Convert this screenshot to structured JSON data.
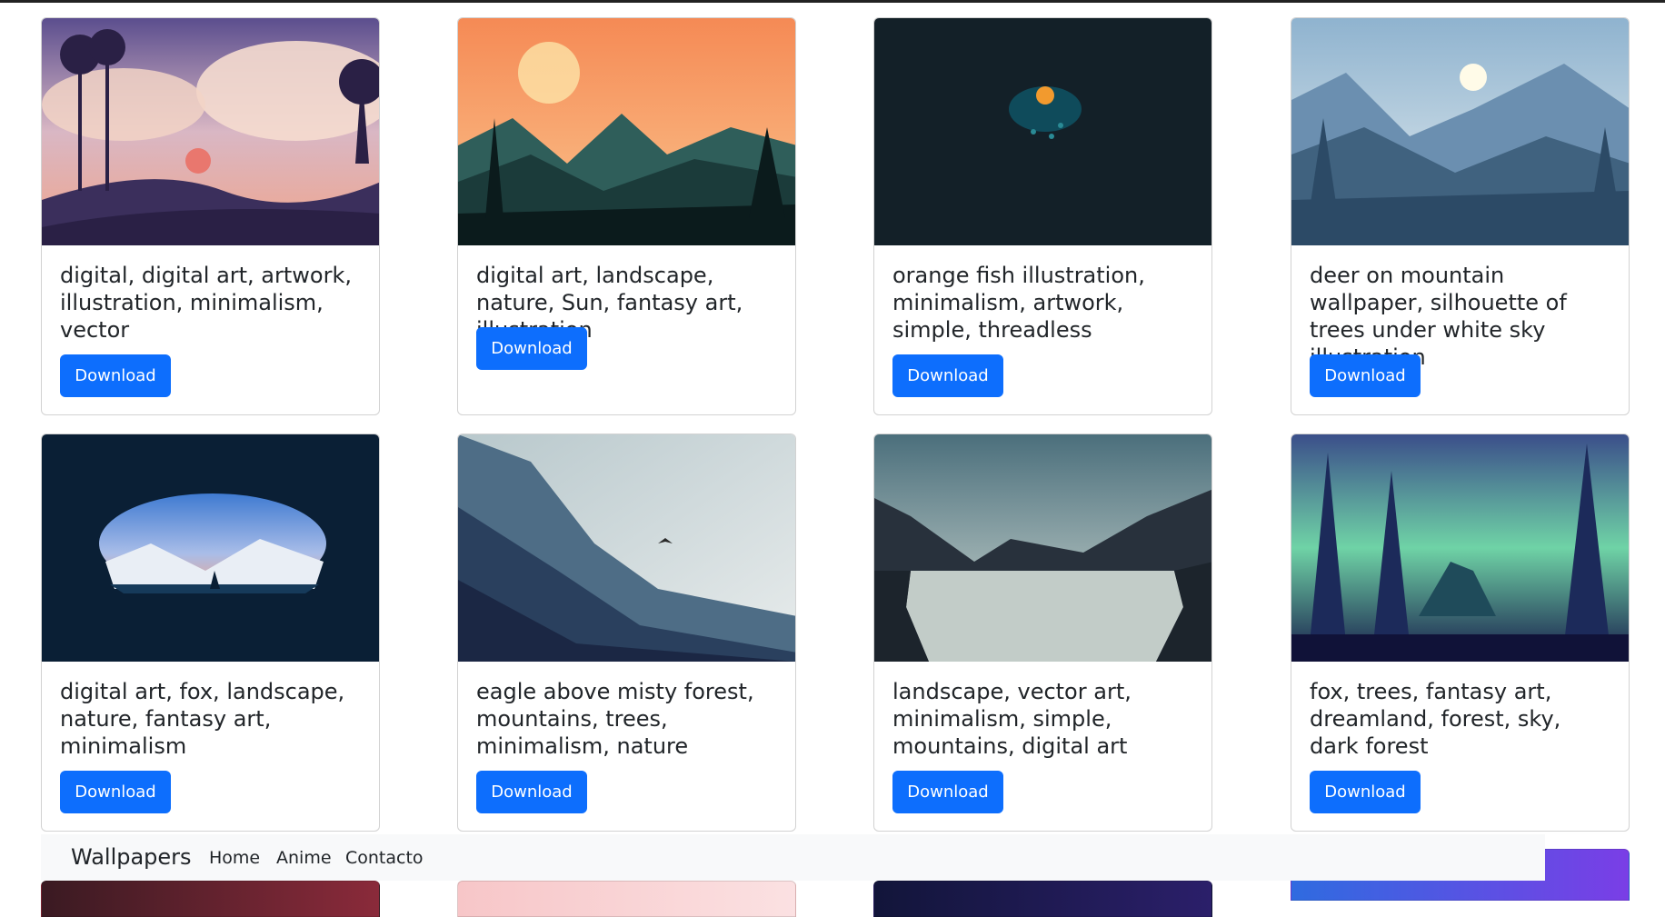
{
  "navbar": {
    "brand": "Wallpapers",
    "links": [
      "Home",
      "Anime",
      "Contacto"
    ]
  },
  "cards": [
    {
      "title": "digital, digital art, artwork, illustration, minimalism, vector",
      "button": "Download"
    },
    {
      "title": "digital art, landscape, nature, Sun, fantasy art, illustration",
      "button": "Download"
    },
    {
      "title": "orange fish illustration, minimalism, artwork, simple, threadless",
      "button": "Download"
    },
    {
      "title": "deer on mountain wallpaper, silhouette of trees under white sky illustration",
      "button": "Download"
    },
    {
      "title": "digital art, fox, landscape, nature, fantasy art, minimalism",
      "button": "Download"
    },
    {
      "title": "eagle above misty forest, mountains, trees, minimalism, nature",
      "button": "Download"
    },
    {
      "title": "landscape, vector art, minimalism, simple, mountains, digital art",
      "button": "Download"
    },
    {
      "title": "fox, trees, fantasy art, dreamland, forest, sky, dark forest",
      "button": "Download"
    }
  ],
  "colors": {
    "primary_button": "#0d6efd",
    "navbar_bg": "#f8f9fa"
  }
}
